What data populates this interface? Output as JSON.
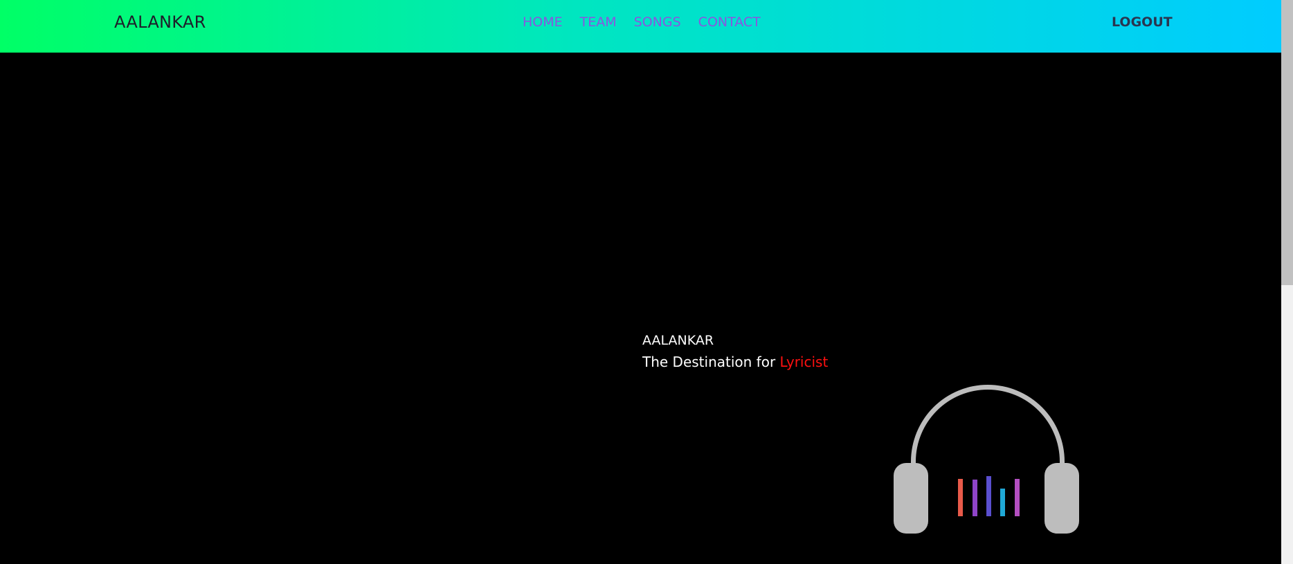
{
  "nav": {
    "brand": "AALANKAR",
    "links": [
      {
        "label": "HOME"
      },
      {
        "label": "TEAM"
      },
      {
        "label": "SONGS"
      },
      {
        "label": "CONTACT"
      }
    ],
    "logout": "LOGOUT"
  },
  "hero": {
    "title": "AALANKAR",
    "tagline_prefix": "The Destination for ",
    "tagline_highlight": "Lyricist"
  },
  "colors": {
    "nav_gradient_start": "#00ff66",
    "nav_gradient_end": "#00ccff",
    "nav_link": "#8a55e0",
    "accent": "#ff1010",
    "headphone_gray": "#bdbdbd",
    "eq_bars": [
      "#e85a4a",
      "#8f44c8",
      "#5a4fcf",
      "#1fa8d6",
      "#b34fc0"
    ]
  },
  "icons": {
    "illustration": "headphones-equalizer-icon"
  }
}
